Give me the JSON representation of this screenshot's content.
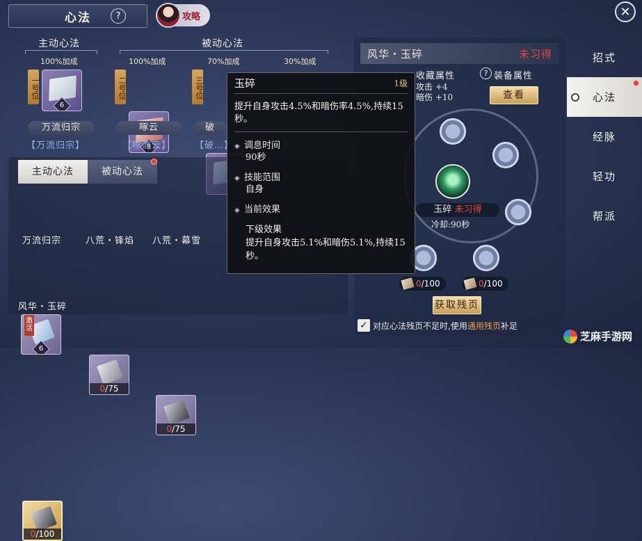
{
  "header": {
    "title": "心法",
    "help": "?",
    "guide_label": "攻略",
    "close": "✕"
  },
  "slots": {
    "active_label": "主动心法",
    "passive_label": "被动心法",
    "items": [
      {
        "bonus": "100%加成",
        "tag": "一号位",
        "level": "6",
        "name": "万流归宗",
        "sub": "【万流归宗】"
      },
      {
        "bonus": "100%加成",
        "tag": "二号位",
        "level": "8",
        "name": "啄云",
        "sub": "【啄流云】"
      },
      {
        "bonus": "70%加成",
        "tag": "三号位",
        "level": "",
        "name": "破",
        "sub": "【破…】"
      },
      {
        "bonus": "30%加成",
        "tag": "",
        "level": "",
        "name": "",
        "sub": ""
      }
    ]
  },
  "lower": {
    "tabs": [
      {
        "label": "主动心法",
        "active": true
      },
      {
        "label": "被动心法",
        "active": false
      }
    ],
    "items": [
      {
        "tag": "激活",
        "count": "6",
        "name": "万流归宗"
      },
      {
        "count_cur": "0",
        "count_max": "/75",
        "name": "八荒・锋焰"
      },
      {
        "count_cur": "0",
        "count_max": "/75",
        "name": "八荒・幕雪"
      },
      {
        "count_cur": "0",
        "count_max": "/100",
        "name": "风华・玉碎"
      }
    ]
  },
  "detail": {
    "name": "风华・玉碎",
    "state": "未习得",
    "collect_label": "收藏属性",
    "equip_label": "装备属性",
    "stat1": "攻击 +4",
    "stat2": "暗伤 +10",
    "view_button": "查看",
    "center_name": "玉碎",
    "center_state": "未习得",
    "cooldown": "冷却:90秒",
    "cost1_cur": "0",
    "cost1_max": "/100",
    "cost2_cur": "0",
    "cost2_max": "/100",
    "obtain_button": "获取残页",
    "checkbox_text_1": "对应心法残页不足时,使用",
    "checkbox_text_hl": "通用残页",
    "checkbox_text_2": "补足"
  },
  "sidenav": {
    "items": [
      "招式",
      "心法",
      "经脉",
      "轻功",
      "帮派"
    ],
    "active_index": 1
  },
  "tooltip": {
    "title": "玉碎",
    "level": "1级",
    "desc": "提升自身攻击4.5%和暗伤率4.5%,持续15秒。",
    "sections": [
      {
        "key": "调息时间",
        "value": "90秒"
      },
      {
        "key": "技能范围",
        "value": "自身"
      },
      {
        "key": "当前效果",
        "value": ""
      }
    ],
    "next_label": "下级效果",
    "next_value": "提升自身攻击5.1%和暗伤5.1%,持续15秒。"
  },
  "watermark": "芝麻手游网",
  "colors": {
    "accent_red": "#e0483e",
    "gold": "#c99d58",
    "panel_bg": "#2a3555"
  }
}
